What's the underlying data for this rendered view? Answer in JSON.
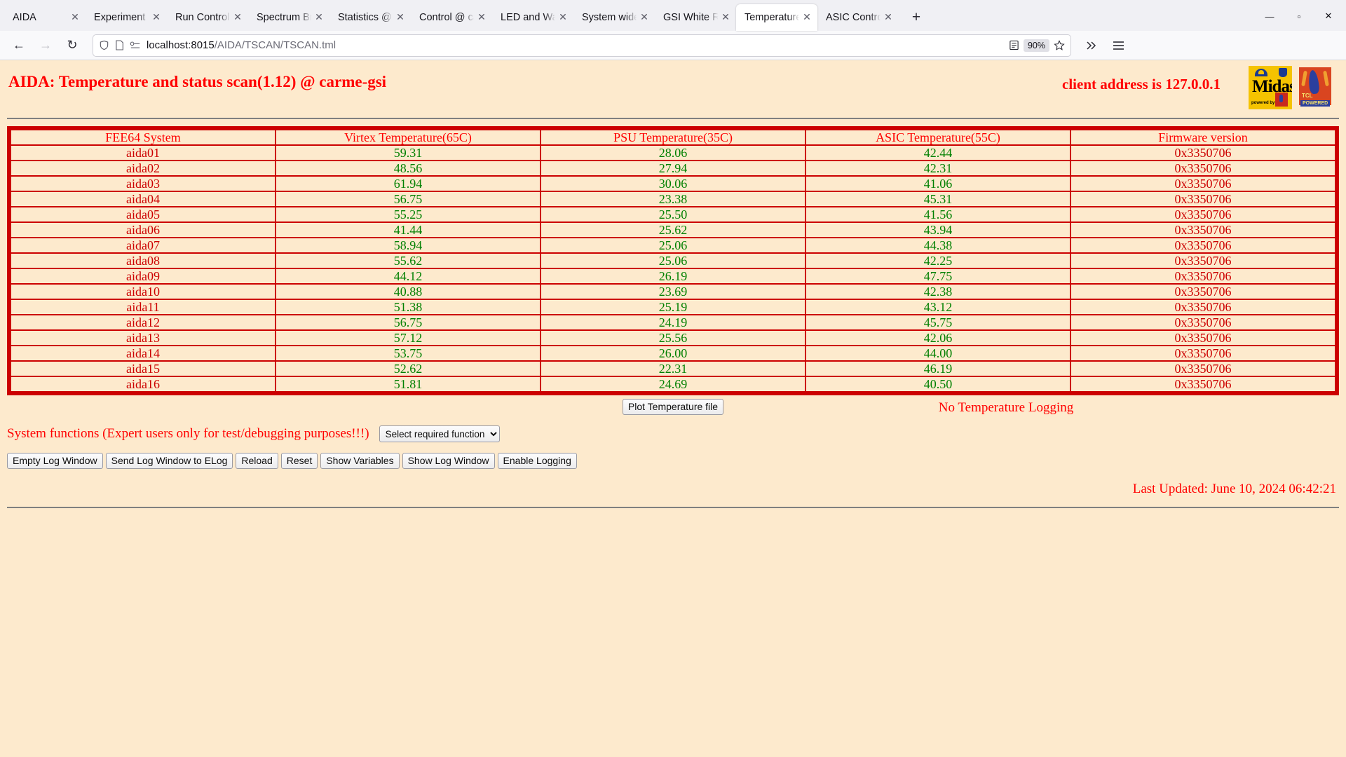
{
  "browser": {
    "tabs": [
      {
        "title": "AIDA",
        "active": false
      },
      {
        "title": "Experiment Control",
        "active": false
      },
      {
        "title": "Run Control @ carme",
        "active": false
      },
      {
        "title": "Spectrum Browser",
        "active": false
      },
      {
        "title": "Statistics @ carme",
        "active": false
      },
      {
        "title": "Control @ carme-gsi",
        "active": false
      },
      {
        "title": "LED and Waveform",
        "active": false
      },
      {
        "title": "System wide Check",
        "active": false
      },
      {
        "title": "GSI White Rabbit Ti",
        "active": false
      },
      {
        "title": "Temperature and st",
        "active": true
      },
      {
        "title": "ASIC Control @ car",
        "active": false
      }
    ],
    "newtab_label": "+",
    "window_controls": {
      "minimize": "—",
      "maximize": "▫",
      "close": "✕"
    },
    "nav": {
      "back": "←",
      "forward": "→",
      "reload": "↻"
    },
    "url": {
      "host": "localhost:8015",
      "path": "/AIDA/TSCAN/TSCAN.tml"
    },
    "zoom_level": "90%"
  },
  "page": {
    "title": "AIDA: Temperature and status scan(1.12) @ carme-gsi",
    "client_address": "client address is 127.0.0.1",
    "logos": {
      "midas": {
        "name": "Midas",
        "sub": "powered by",
        "tcl": "TCL"
      },
      "tcl": {
        "line1": "TCL",
        "line2": "POWERED"
      }
    },
    "table": {
      "headers": [
        "FEE64 System",
        "Virtex Temperature(65C)",
        "PSU Temperature(35C)",
        "ASIC Temperature(55C)",
        "Firmware version"
      ],
      "rows": [
        {
          "system": "aida01",
          "virtex": "59.31",
          "psu": "28.06",
          "asic": "42.44",
          "firmware": "0x3350706"
        },
        {
          "system": "aida02",
          "virtex": "48.56",
          "psu": "27.94",
          "asic": "42.31",
          "firmware": "0x3350706"
        },
        {
          "system": "aida03",
          "virtex": "61.94",
          "psu": "30.06",
          "asic": "41.06",
          "firmware": "0x3350706"
        },
        {
          "system": "aida04",
          "virtex": "56.75",
          "psu": "23.38",
          "asic": "45.31",
          "firmware": "0x3350706"
        },
        {
          "system": "aida05",
          "virtex": "55.25",
          "psu": "25.50",
          "asic": "41.56",
          "firmware": "0x3350706"
        },
        {
          "system": "aida06",
          "virtex": "41.44",
          "psu": "25.62",
          "asic": "43.94",
          "firmware": "0x3350706"
        },
        {
          "system": "aida07",
          "virtex": "58.94",
          "psu": "25.06",
          "asic": "44.38",
          "firmware": "0x3350706"
        },
        {
          "system": "aida08",
          "virtex": "55.62",
          "psu": "25.06",
          "asic": "42.25",
          "firmware": "0x3350706"
        },
        {
          "system": "aida09",
          "virtex": "44.12",
          "psu": "26.19",
          "asic": "47.75",
          "firmware": "0x3350706"
        },
        {
          "system": "aida10",
          "virtex": "40.88",
          "psu": "23.69",
          "asic": "42.38",
          "firmware": "0x3350706"
        },
        {
          "system": "aida11",
          "virtex": "51.38",
          "psu": "25.19",
          "asic": "43.12",
          "firmware": "0x3350706"
        },
        {
          "system": "aida12",
          "virtex": "56.75",
          "psu": "24.19",
          "asic": "45.75",
          "firmware": "0x3350706"
        },
        {
          "system": "aida13",
          "virtex": "57.12",
          "psu": "25.56",
          "asic": "42.06",
          "firmware": "0x3350706"
        },
        {
          "system": "aida14",
          "virtex": "53.75",
          "psu": "26.00",
          "asic": "44.00",
          "firmware": "0x3350706"
        },
        {
          "system": "aida15",
          "virtex": "52.62",
          "psu": "22.31",
          "asic": "46.19",
          "firmware": "0x3350706"
        },
        {
          "system": "aida16",
          "virtex": "51.81",
          "psu": "24.69",
          "asic": "40.50",
          "firmware": "0x3350706"
        }
      ]
    },
    "controls": {
      "plot_button": "Plot Temperature file",
      "logging_status": "No Temperature Logging",
      "system_functions_label": "System functions (Expert users only for test/debugging purposes!!!)",
      "function_select_value": "Select required function",
      "buttons": [
        "Empty Log Window",
        "Send Log Window to ELog",
        "Reload",
        "Reset",
        "Show Variables",
        "Show Log Window",
        "Enable Logging"
      ]
    },
    "last_updated": "Last Updated: June 10, 2024 06:42:21",
    "colors": {
      "background": "#fdeacd",
      "red": "#ff0000",
      "table_border": "#cc0000",
      "value_green": "#008000"
    }
  }
}
